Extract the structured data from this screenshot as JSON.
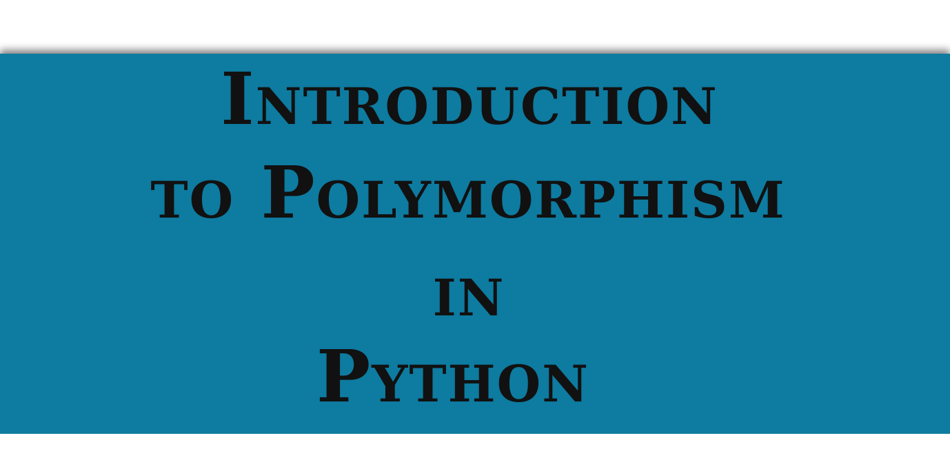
{
  "title": {
    "line1": "Introduction",
    "line2": "to Polymorphism",
    "line3": "in",
    "line4": "Python"
  },
  "colors": {
    "banner": "#0e7ba0",
    "text": "#111111",
    "background": "#ffffff"
  }
}
